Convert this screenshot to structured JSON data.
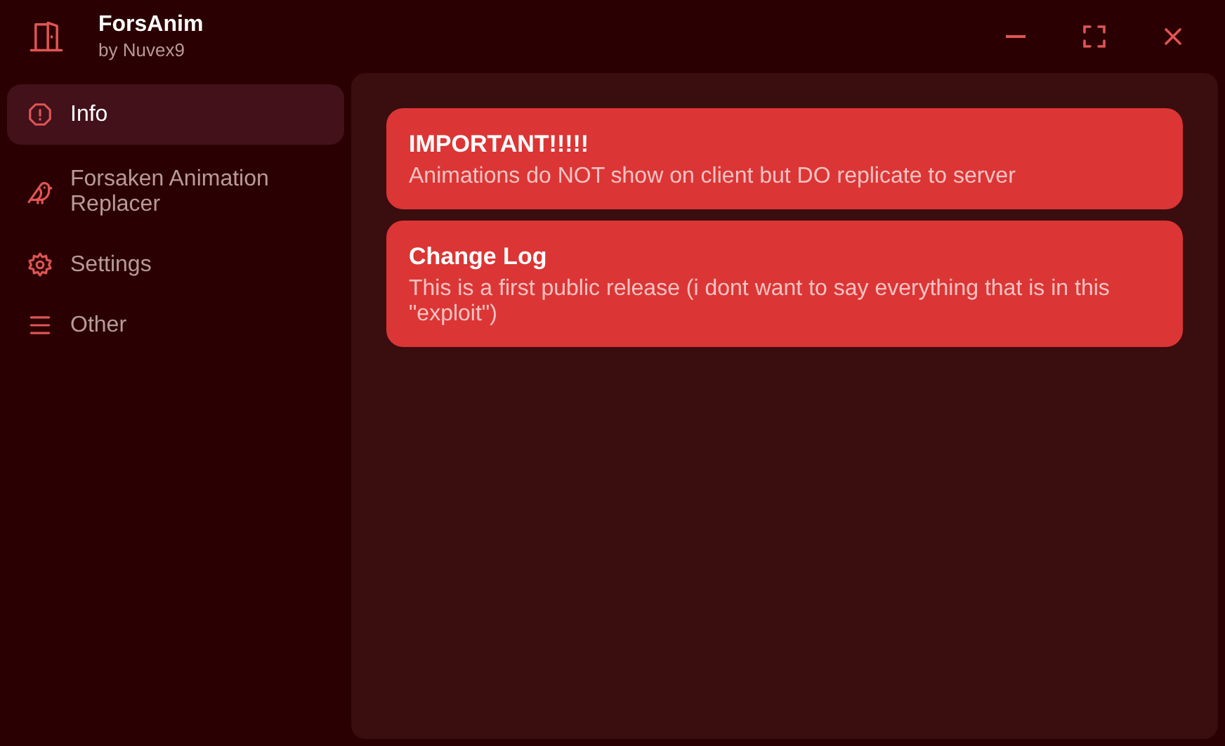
{
  "window": {
    "title": "ForsAnim",
    "subtitle": "by Nuvex9"
  },
  "sidebar": {
    "items": [
      {
        "label": "Info",
        "selected": true
      },
      {
        "label": "Forsaken Animation Replacer",
        "selected": false
      },
      {
        "label": "Settings",
        "selected": false
      },
      {
        "label": "Other",
        "selected": false
      }
    ]
  },
  "cards": [
    {
      "title": "IMPORTANT!!!!!",
      "text": "Animations do NOT show on client but DO replicate to server"
    },
    {
      "title": "Change Log",
      "text": "This is a first public release (i dont want to say everything that is in this \"exploit\")"
    }
  ]
}
